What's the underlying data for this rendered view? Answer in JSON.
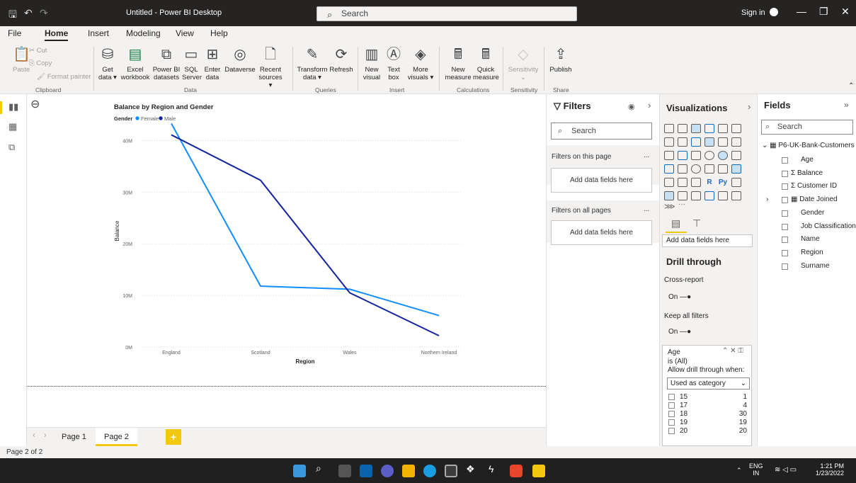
{
  "titlebar": {
    "title": "Untitled - Power BI Desktop",
    "search_placeholder": "Search",
    "sign_in": "Sign in"
  },
  "menu": [
    "File",
    "Home",
    "Insert",
    "Modeling",
    "View",
    "Help"
  ],
  "ribbon": {
    "clipboard": {
      "paste": "Paste",
      "cut": "Cut",
      "copy": "Copy",
      "format_painter": "Format painter",
      "group": "Clipboard"
    },
    "data": {
      "get_data_1": "Get",
      "get_data_2": "data",
      "excel_1": "Excel",
      "excel_2": "workbook",
      "pbi_1": "Power BI",
      "pbi_2": "datasets",
      "sql_1": "SQL",
      "sql_2": "Server",
      "enter_1": "Enter",
      "enter_2": "data",
      "dataverse": "Dataverse",
      "recent_1": "Recent",
      "recent_2": "sources",
      "group": "Data"
    },
    "queries": {
      "transform_1": "Transform",
      "transform_2": "data",
      "refresh": "Refresh",
      "group": "Queries"
    },
    "insert": {
      "new_visual_1": "New",
      "new_visual_2": "visual",
      "text_box_1": "Text",
      "text_box_2": "box",
      "more_1": "More",
      "more_2": "visuals",
      "group": "Insert"
    },
    "calculations": {
      "new_measure_1": "New",
      "new_measure_2": "measure",
      "quick_1": "Quick",
      "quick_2": "measure",
      "group": "Calculations"
    },
    "sensitivity": {
      "label": "Sensitivity",
      "group": "Sensitivity"
    },
    "share": {
      "publish": "Publish",
      "group": "Share"
    }
  },
  "pages": {
    "tabs": [
      "Page 1",
      "Page 2"
    ],
    "add": "+",
    "status": "Page 2 of 2"
  },
  "filters": {
    "title": "Filters",
    "search": "Search",
    "on_this_page": "Filters on this page",
    "on_all_pages": "Filters on all pages",
    "add_fields": "Add data fields here",
    "more": "..."
  },
  "visualizations": {
    "title": "Visualizations",
    "add_fields": "Add data fields here",
    "drill_through": "Drill through",
    "cross_report": "Cross-report",
    "keep_all_filters": "Keep all filters",
    "on": "On",
    "age_card": {
      "field": "Age",
      "is_all": "is (All)",
      "allow": "Allow drill through when:",
      "dropdown": "Used as category",
      "rows": [
        {
          "value": "15",
          "count": "1"
        },
        {
          "value": "17",
          "count": "4"
        },
        {
          "value": "18",
          "count": "30"
        },
        {
          "value": "19",
          "count": "19"
        },
        {
          "value": "20",
          "count": "20"
        }
      ]
    },
    "r_label": "R",
    "py_label": "Py",
    "ellipsis": "···"
  },
  "fields": {
    "title": "Fields",
    "search": "Search",
    "table": "P6-UK-Bank-Customers",
    "items": [
      {
        "name": "Age",
        "sigma": false
      },
      {
        "name": "Balance",
        "sigma": true
      },
      {
        "name": "Customer ID",
        "sigma": true
      },
      {
        "name": "Date Joined",
        "sigma": false
      },
      {
        "name": "Gender",
        "sigma": false
      },
      {
        "name": "Job Classification",
        "sigma": false
      },
      {
        "name": "Name",
        "sigma": false
      },
      {
        "name": "Region",
        "sigma": false
      },
      {
        "name": "Surname",
        "sigma": false
      }
    ]
  },
  "taskbar": {
    "lang_1": "ENG",
    "lang_2": "IN",
    "time": "1:21 PM",
    "date": "1/23/2022"
  },
  "chart_data": {
    "type": "line",
    "title": "Balance by Region and Gender",
    "legend_title": "Gender",
    "legend_position": "top-left",
    "xlabel": "Region",
    "ylabel": "Balance",
    "categories": [
      "England",
      "Scotland",
      "Wales",
      "Northern Ireland"
    ],
    "yticks": [
      "0M",
      "10M",
      "20M",
      "30M",
      "40M"
    ],
    "ylim": [
      0,
      45
    ],
    "grid": true,
    "series": [
      {
        "name": "Female",
        "color": "#118dff",
        "values": [
          43.3,
          11.8,
          11.2,
          6.1
        ]
      },
      {
        "name": "Male",
        "color": "#12239e",
        "values": [
          41.1,
          32.3,
          10.5,
          2.2
        ]
      }
    ]
  }
}
